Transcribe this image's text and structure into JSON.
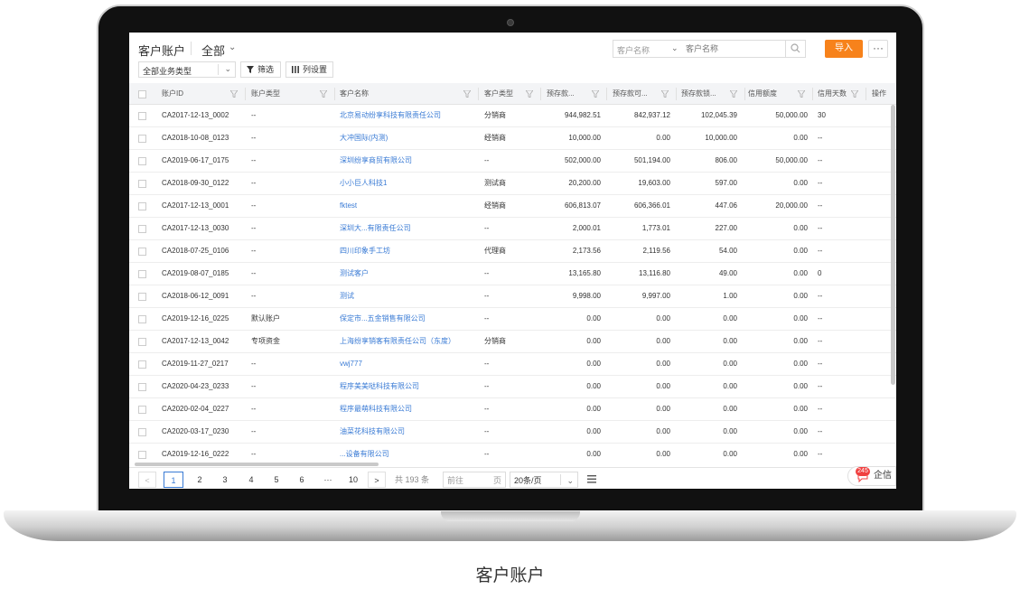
{
  "caption": "客户账户",
  "header": {
    "title": "客户账户",
    "scope": "全部",
    "search_field": "客户名称",
    "search_placeholder": "客户名称",
    "import_label": "导入",
    "more_label": "···"
  },
  "toolbar": {
    "biz_type": "全部业务类型",
    "filter_label": "筛选",
    "colset_label": "列设置"
  },
  "columns": [
    "账户ID",
    "账户类型",
    "客户名称",
    "客户类型",
    "预存款...",
    "预存款可...",
    "预存款锁...",
    "信用额度",
    "信用天数",
    "操作"
  ],
  "rows": [
    [
      "CA2017-12-13_0002",
      "--",
      "北京易动纷享科技有限责任公司",
      "分销商",
      "944,982.51",
      "842,937.12",
      "102,045.39",
      "50,000.00",
      "30"
    ],
    [
      "CA2018-10-08_0123",
      "--",
      "大冲国际(内测)",
      "经销商",
      "10,000.00",
      "0.00",
      "10,000.00",
      "0.00",
      "--"
    ],
    [
      "CA2019-06-17_0175",
      "--",
      "深圳纷享商贸有限公司",
      "--",
      "502,000.00",
      "501,194.00",
      "806.00",
      "50,000.00",
      "--"
    ],
    [
      "CA2018-09-30_0122",
      "--",
      "小小巨人科技1",
      "测试商",
      "20,200.00",
      "19,603.00",
      "597.00",
      "0.00",
      "--"
    ],
    [
      "CA2017-12-13_0001",
      "--",
      "fktest",
      "经销商",
      "606,813.07",
      "606,366.01",
      "447.06",
      "20,000.00",
      "--"
    ],
    [
      "CA2017-12-13_0030",
      "--",
      "深圳大...有限责任公司",
      "--",
      "2,000.01",
      "1,773.01",
      "227.00",
      "0.00",
      "--"
    ],
    [
      "CA2018-07-25_0106",
      "--",
      "四川印象手工坊",
      "代理商",
      "2,173.56",
      "2,119.56",
      "54.00",
      "0.00",
      "--"
    ],
    [
      "CA2019-08-07_0185",
      "--",
      "测试客户",
      "--",
      "13,165.80",
      "13,116.80",
      "49.00",
      "0.00",
      "0"
    ],
    [
      "CA2018-06-12_0091",
      "--",
      "测试",
      "--",
      "9,998.00",
      "9,997.00",
      "1.00",
      "0.00",
      "--"
    ],
    [
      "CA2019-12-16_0225",
      "默认账户",
      "保定市...五金销售有限公司",
      "--",
      "0.00",
      "0.00",
      "0.00",
      "0.00",
      "--"
    ],
    [
      "CA2017-12-13_0042",
      "专项资金",
      "上海纷享销客有限责任公司（东度）",
      "分销商",
      "0.00",
      "0.00",
      "0.00",
      "0.00",
      "--"
    ],
    [
      "CA2019-11-27_0217",
      "--",
      "vwj777",
      "--",
      "0.00",
      "0.00",
      "0.00",
      "0.00",
      "--"
    ],
    [
      "CA2020-04-23_0233",
      "--",
      "程序美美哒科技有限公司",
      "--",
      "0.00",
      "0.00",
      "0.00",
      "0.00",
      "--"
    ],
    [
      "CA2020-02-04_0227",
      "--",
      "程序最萌科技有限公司",
      "--",
      "0.00",
      "0.00",
      "0.00",
      "0.00",
      "--"
    ],
    [
      "CA2020-03-17_0230",
      "--",
      "油菜花科技有限公司",
      "--",
      "0.00",
      "0.00",
      "0.00",
      "0.00",
      "--"
    ],
    [
      "CA2019-12-16_0222",
      "--",
      "...设备有限公司",
      "--",
      "0.00",
      "0.00",
      "0.00",
      "0.00",
      "--"
    ]
  ],
  "pager": {
    "prev": "<",
    "pages": [
      "1",
      "2",
      "3",
      "4",
      "5",
      "6",
      "···",
      "10"
    ],
    "active": "1",
    "next": ">",
    "total": "共 193 条",
    "jump_prefix": "前往",
    "jump_suffix": "页",
    "page_size": "20条/页"
  },
  "qiye": {
    "badge": "245",
    "label": "企信"
  },
  "colors": {
    "accent": "#f7821b",
    "link": "#3a7bd5",
    "badge": "#f04040"
  }
}
